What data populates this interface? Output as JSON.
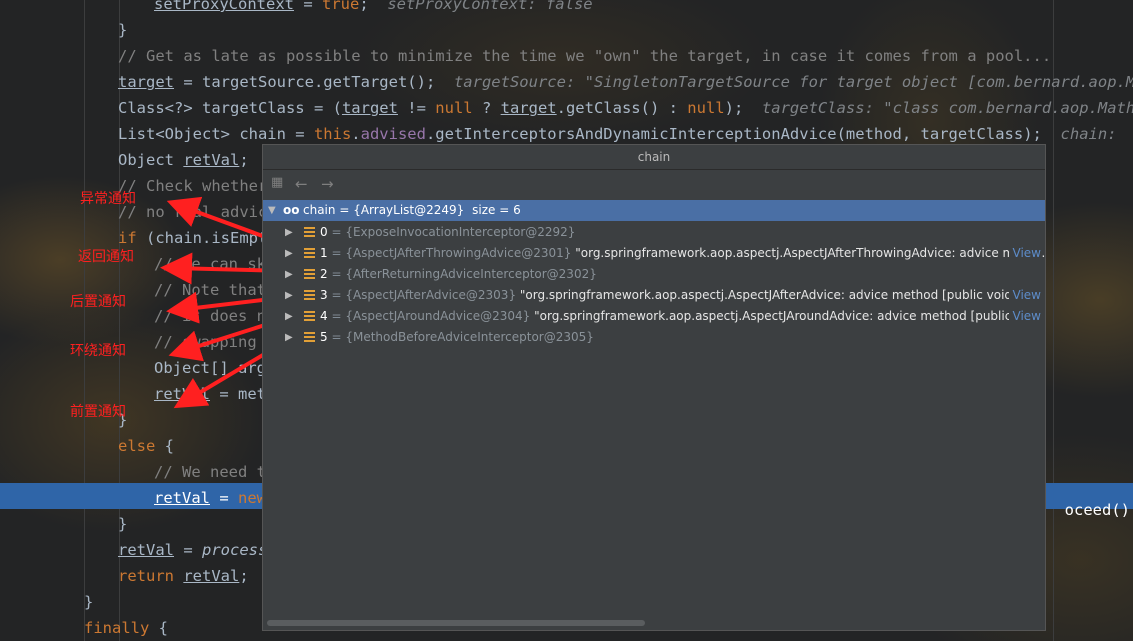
{
  "code_lines": [
    {
      "t": [
        {
          "s": "setProxyContext",
          "c": "ul"
        },
        {
          "s": " = "
        },
        {
          "s": "true",
          "c": "kw"
        },
        {
          "s": ";  "
        },
        {
          "s": "setProxyContext: false",
          "c": "inl"
        }
      ]
    },
    {
      "t": [
        {
          "s": "}"
        }
      ]
    },
    {
      "t": [
        {
          "s": "// Get as late as possible to minimize the time we \"own\" the target, in case it comes from a pool...",
          "c": "cm"
        }
      ]
    },
    {
      "t": [
        {
          "s": "target",
          "c": "ul"
        },
        {
          "s": " = targetSource.getTarget();  "
        },
        {
          "s": "targetSource: \"SingletonTargetSource for target object [com.bernard.aop.MathC",
          "c": "inl"
        }
      ]
    },
    {
      "t": [
        {
          "s": "Class<?> targetClass = ("
        },
        {
          "s": "target",
          "c": "ul"
        },
        {
          "s": " != "
        },
        {
          "s": "null",
          "c": "kw"
        },
        {
          "s": " ? "
        },
        {
          "s": "target",
          "c": "ul"
        },
        {
          "s": ".getClass() : "
        },
        {
          "s": "null",
          "c": "kw"
        },
        {
          "s": ");  "
        },
        {
          "s": "targetClass: \"class com.bernard.aop.MathCalc",
          "c": "inl"
        }
      ]
    },
    {
      "t": [
        {
          "s": "List<Object> chain = "
        },
        {
          "s": "this",
          "c": "kw"
        },
        {
          "s": "."
        },
        {
          "s": "advised",
          "c": "fld"
        },
        {
          "s": ".getInterceptorsAndDynamicInterceptionAdvice(method, targetClass);  "
        },
        {
          "s": "chain:  size",
          "c": "inl"
        }
      ]
    },
    {
      "t": [
        {
          "s": "Object "
        },
        {
          "s": "retVal",
          "c": "ul"
        },
        {
          "s": ";"
        }
      ]
    },
    {
      "t": [
        {
          "s": "// Check whether",
          "c": "cm"
        }
      ]
    },
    {
      "t": [
        {
          "s": "// no real advic",
          "c": "cm"
        }
      ]
    },
    {
      "t": [
        {
          "s": "if",
          "c": "kw"
        },
        {
          "s": " (chain.isEmpt"
        }
      ]
    },
    {
      "t": [
        {
          "s": "// We can sk",
          "c": "cm"
        }
      ]
    },
    {
      "t": [
        {
          "s": "// Note that",
          "c": "cm"
        }
      ]
    },
    {
      "t": [
        {
          "s": "// it does n",
          "c": "cm"
        }
      ]
    },
    {
      "t": [
        {
          "s": "// swapping",
          "c": "cm"
        }
      ]
    },
    {
      "t": [
        {
          "s": "Object[] arg"
        }
      ]
    },
    {
      "t": [
        {
          "s": "retVal",
          "c": "ul"
        },
        {
          "s": " = met"
        }
      ]
    },
    {
      "t": [
        {
          "s": "}"
        }
      ]
    },
    {
      "t": [
        {
          "s": "else",
          "c": "kw"
        },
        {
          "s": " {"
        }
      ]
    },
    {
      "t": [
        {
          "s": "// We need t",
          "c": "cm"
        }
      ]
    },
    {
      "t": [
        {
          "s": "retVal",
          "c": "ul"
        },
        {
          "s": " = "
        },
        {
          "s": "new",
          "c": "kw"
        }
      ]
    },
    {
      "t": [
        {
          "s": "}"
        }
      ]
    },
    {
      "t": [
        {
          "s": "retVal",
          "c": "ul"
        },
        {
          "s": " = "
        },
        {
          "s": "process",
          "c": "it"
        }
      ]
    },
    {
      "t": [
        {
          "s": "return",
          "c": "kw"
        },
        {
          "s": " "
        },
        {
          "s": "retVal",
          "c": "ul"
        },
        {
          "s": ";"
        }
      ]
    },
    {
      "t": [
        {
          "s": "}"
        }
      ]
    },
    {
      "t": [
        {
          "s": "finally",
          "c": "kw"
        },
        {
          "s": " {"
        }
      ]
    }
  ],
  "code_line_right_tail": "oceed();",
  "annotations": {
    "throwing": "异常通知",
    "returning": "返回通知",
    "after": "后置通知",
    "around": "环绕通知",
    "before": "前置通知"
  },
  "popup": {
    "title": "chain",
    "root": {
      "name": "chain",
      "value": "{ArrayList@2249}",
      "size": "size = 6"
    },
    "items": [
      {
        "index": "0",
        "ref": "{ExposeInvocationInterceptor@2292}",
        "detail": ""
      },
      {
        "index": "1",
        "ref": "{AspectJAfterThrowingAdvice@2301}",
        "detail": "\"org.springframework.aop.aspectj.AspectJAfterThrowingAdvice: advice meth...",
        "view": "View"
      },
      {
        "index": "2",
        "ref": "{AfterReturningAdviceInterceptor@2302}",
        "detail": ""
      },
      {
        "index": "3",
        "ref": "{AspectJAfterAdvice@2303}",
        "detail": "\"org.springframework.aop.aspectj.AspectJAfterAdvice: advice method [public void co...",
        "view": "View"
      },
      {
        "index": "4",
        "ref": "{AspectJAroundAdvice@2304}",
        "detail": "\"org.springframework.aop.aspectj.AspectJAroundAdvice: advice method [public ja...",
        "view": "View"
      },
      {
        "index": "5",
        "ref": "{MethodBeforeAdviceInterceptor@2305}",
        "detail": ""
      }
    ]
  },
  "colors": {
    "background": "#232425",
    "keyword": "#cc7832",
    "comment": "#808080",
    "selection": "#2f65a8",
    "annotation_red": "#ff2020"
  }
}
